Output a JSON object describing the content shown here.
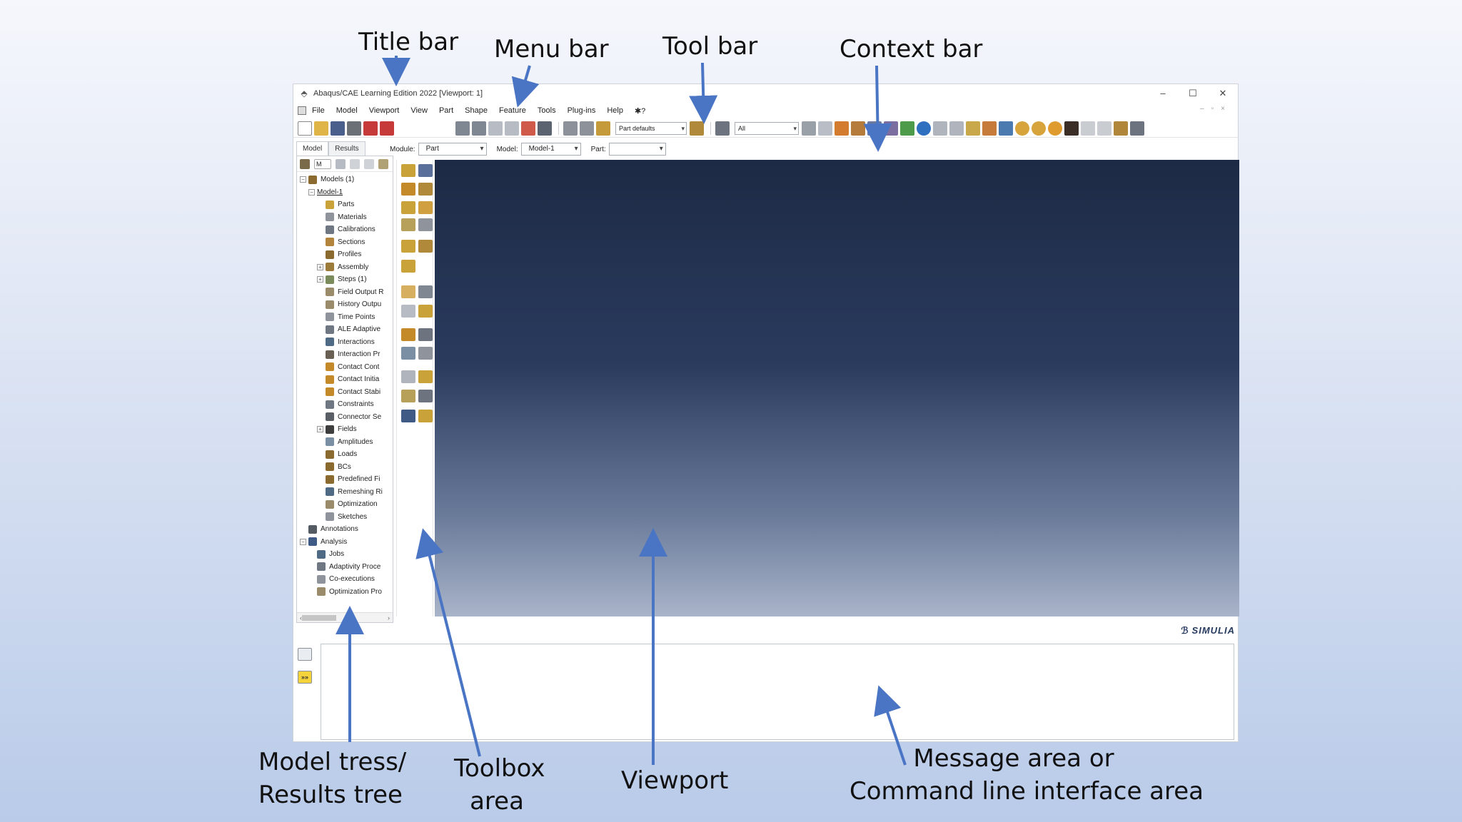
{
  "callouts": {
    "title_bar": "Title bar",
    "menu_bar": "Menu bar",
    "tool_bar": "Tool bar",
    "context_bar": "Context bar",
    "model_tree_line1": "Model tress/",
    "model_tree_line2": "Results tree",
    "toolbox_line1": "Toolbox",
    "toolbox_line2": "area",
    "viewport": "Viewport",
    "message_line1": "Message area or",
    "message_line2": "Command line interface area"
  },
  "window": {
    "title": "Abaqus/CAE Learning Edition 2022 [Viewport: 1]",
    "controls": [
      "–",
      "☐",
      "✕"
    ]
  },
  "menu": {
    "items": [
      "File",
      "Model",
      "Viewport",
      "View",
      "Part",
      "Shape",
      "Feature",
      "Tools",
      "Plug-ins",
      "Help",
      "✱?"
    ]
  },
  "toolbar": {
    "part_defaults": "Part defaults",
    "selection_filter": "All"
  },
  "context": {
    "module_label": "Module:",
    "module_value": "Part",
    "model_label": "Model:",
    "model_value": "Model-1",
    "part_label": "Part:",
    "part_value": ""
  },
  "tabs": {
    "model": "Model",
    "results": "Results"
  },
  "tree": {
    "combo": "M",
    "nodes": [
      {
        "label": "Models (1)",
        "indent": 0,
        "expander": "⊟",
        "color": "#8a6a2f"
      },
      {
        "label": "Model-1",
        "indent": 1,
        "expander": "⊟",
        "color": ""
      },
      {
        "label": "Parts",
        "indent": 2,
        "expander": "",
        "color": "#c9a23a"
      },
      {
        "label": "Materials",
        "indent": 2,
        "expander": "",
        "color": "#8f949c"
      },
      {
        "label": "Calibrations",
        "indent": 2,
        "expander": "",
        "color": "#6f7882"
      },
      {
        "label": "Sections",
        "indent": 2,
        "expander": "",
        "color": "#b3843c"
      },
      {
        "label": "Profiles",
        "indent": 2,
        "expander": "",
        "color": "#8a6a2f"
      },
      {
        "label": "Assembly",
        "indent": 2,
        "expander": "⊞",
        "color": "#9b7a3a"
      },
      {
        "label": "Steps (1)",
        "indent": 2,
        "expander": "⊞",
        "color": "#7c8b5c"
      },
      {
        "label": "Field Output R",
        "indent": 2,
        "expander": "",
        "color": "#9a8b6a"
      },
      {
        "label": "History Outpu",
        "indent": 2,
        "expander": "",
        "color": "#9a8b6a"
      },
      {
        "label": "Time Points",
        "indent": 2,
        "expander": "",
        "color": "#8f949c"
      },
      {
        "label": "ALE Adaptive",
        "indent": 2,
        "expander": "",
        "color": "#6f7882"
      },
      {
        "label": "Interactions",
        "indent": 2,
        "expander": "",
        "color": "#4f6a85"
      },
      {
        "label": "Interaction Pr",
        "indent": 2,
        "expander": "",
        "color": "#6a5f53"
      },
      {
        "label": "Contact Cont",
        "indent": 2,
        "expander": "",
        "color": "#c48a2a"
      },
      {
        "label": "Contact Initia",
        "indent": 2,
        "expander": "",
        "color": "#c48a2a"
      },
      {
        "label": "Contact Stabi",
        "indent": 2,
        "expander": "",
        "color": "#c48a2a"
      },
      {
        "label": "Constraints",
        "indent": 2,
        "expander": "",
        "color": "#6f7882"
      },
      {
        "label": "Connector Se",
        "indent": 2,
        "expander": "",
        "color": "#5a5f66"
      },
      {
        "label": "Fields",
        "indent": 2,
        "expander": "⊞",
        "color": "#3d3d3d"
      },
      {
        "label": "Amplitudes",
        "indent": 2,
        "expander": "",
        "color": "#7a8ea4"
      },
      {
        "label": "Loads",
        "indent": 2,
        "expander": "",
        "color": "#8a6a2f"
      },
      {
        "label": "BCs",
        "indent": 2,
        "expander": "",
        "color": "#8a6a2f"
      },
      {
        "label": "Predefined Fi",
        "indent": 2,
        "expander": "",
        "color": "#8a6a2f"
      },
      {
        "label": "Remeshing Ri",
        "indent": 2,
        "expander": "",
        "color": "#4f6a85"
      },
      {
        "label": "Optimization",
        "indent": 2,
        "expander": "",
        "color": "#9a8b6a"
      },
      {
        "label": "Sketches",
        "indent": 2,
        "expander": "",
        "color": "#8f949c"
      },
      {
        "label": "Annotations",
        "indent": 0,
        "expander": "",
        "color": "#555b63"
      },
      {
        "label": "Analysis",
        "indent": 0,
        "expander": "⊟",
        "color": "#3f5b85"
      },
      {
        "label": "Jobs",
        "indent": 1,
        "expander": "",
        "color": "#4f6a85"
      },
      {
        "label": "Adaptivity Proce",
        "indent": 1,
        "expander": "",
        "color": "#6f7882"
      },
      {
        "label": "Co-executions",
        "indent": 1,
        "expander": "",
        "color": "#8f949c"
      },
      {
        "label": "Optimization Pro",
        "indent": 1,
        "expander": "",
        "color": "#9a8b6a"
      }
    ]
  },
  "brand": {
    "logo": "SIMULIA"
  },
  "message_area": {
    "cli_icon": "»»"
  }
}
